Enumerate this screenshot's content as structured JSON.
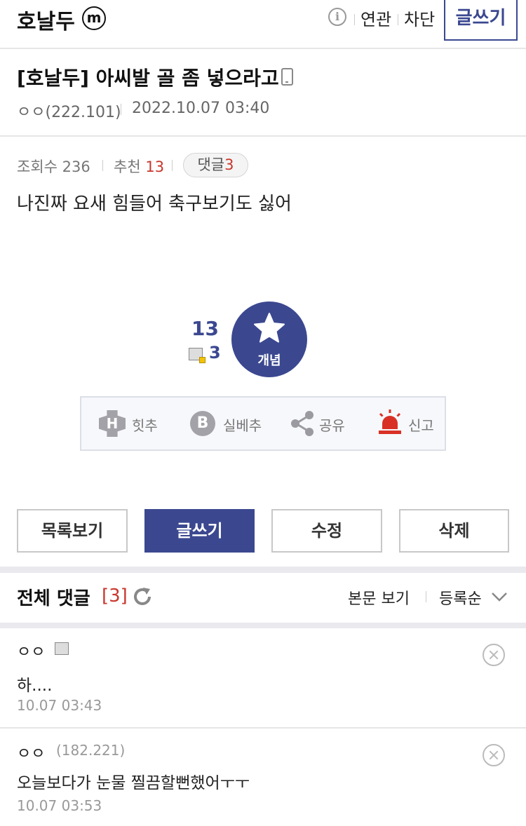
{
  "header": {
    "gallery_name": "호날두",
    "minor_badge": "m",
    "info_icon": "i",
    "related_label": "연관",
    "block_label": "차단",
    "write_label": "글쓰기"
  },
  "post": {
    "title": "[호날두] 아씨발 골 좀 넣으라고",
    "author": "ㅇㅇ(222.101)",
    "date": "2022.10.07 03:40",
    "views_label": "조회수",
    "views": "236",
    "recommend_label": "추천",
    "recommend": "13",
    "comments_label": "댓글",
    "comments": "3",
    "body": "나진짜 요새 힘들어 축구보기도 싫어"
  },
  "recommend": {
    "count": "13",
    "fixed_count": "3",
    "concept_label": "개념"
  },
  "actions": {
    "hit_letter": "H",
    "hit_label": "힛추",
    "best_letter": "B",
    "best_label": "실베추",
    "share_label": "공유",
    "report_label": "신고"
  },
  "buttons": {
    "list": "목록보기",
    "write": "글쓰기",
    "edit": "수정",
    "delete": "삭제"
  },
  "comments_section": {
    "title": "전체 댓글",
    "count": "[3]",
    "view_body": "본문 보기",
    "sort": "등록순"
  },
  "comments": [
    {
      "name": "ㅇㅇ",
      "text": "하....",
      "date": "10.07 03:43"
    },
    {
      "name": "ㅇㅇ",
      "ip": "(182.221)",
      "text": "오늘보다가 눈물 찔끔할뻔했어ㅜㅜ",
      "date": "10.07 03:53"
    }
  ],
  "colors": {
    "accent": "#3b4890",
    "highlight_red": "#c8372d",
    "report_red": "#d93025"
  }
}
